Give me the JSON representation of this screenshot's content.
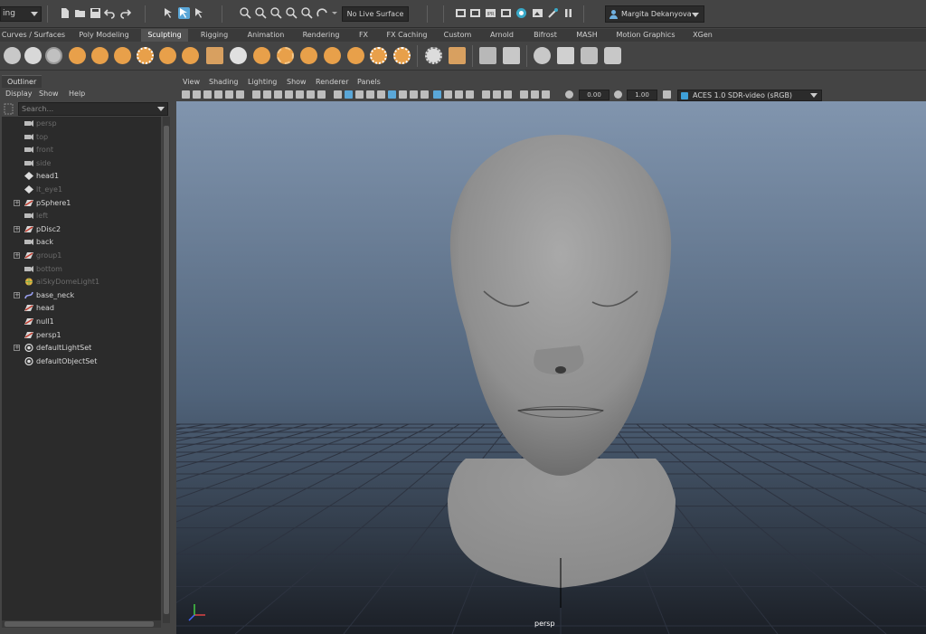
{
  "status_line": {
    "menu_set": "ing",
    "live_surface": "No Live Surface",
    "user_name": "Margita Dekanyova"
  },
  "shelf_tabs": [
    {
      "label": "Curves / Surfaces",
      "active": false
    },
    {
      "label": "Poly Modeling",
      "active": false
    },
    {
      "label": "Sculpting",
      "active": true
    },
    {
      "label": "Rigging",
      "active": false
    },
    {
      "label": "Animation",
      "active": false
    },
    {
      "label": "Rendering",
      "active": false
    },
    {
      "label": "FX",
      "active": false
    },
    {
      "label": "FX Caching",
      "active": false
    },
    {
      "label": "Custom",
      "active": false
    },
    {
      "label": "Arnold",
      "active": false
    },
    {
      "label": "Bifrost",
      "active": false
    },
    {
      "label": "MASH",
      "active": false
    },
    {
      "label": "Motion Graphics",
      "active": false
    },
    {
      "label": "XGen",
      "active": false
    }
  ],
  "outliner": {
    "title": "Outliner",
    "menus": [
      "Display",
      "Show",
      "Help"
    ],
    "search_placeholder": "Search...",
    "items": [
      {
        "label": "persp",
        "icon": "camera-icon",
        "dim": true,
        "expandable": false
      },
      {
        "label": "top",
        "icon": "camera-icon",
        "dim": true,
        "expandable": false
      },
      {
        "label": "front",
        "icon": "camera-icon",
        "dim": true,
        "expandable": false
      },
      {
        "label": "side",
        "icon": "camera-icon",
        "dim": true,
        "expandable": false
      },
      {
        "label": "head1",
        "icon": "locator-icon",
        "dim": false,
        "expandable": false
      },
      {
        "label": "lt_eye1",
        "icon": "locator-icon",
        "dim": true,
        "expandable": false
      },
      {
        "label": "pSphere1",
        "icon": "mesh-icon",
        "dim": false,
        "expandable": true
      },
      {
        "label": "left",
        "icon": "camera-icon",
        "dim": true,
        "expandable": false
      },
      {
        "label": "pDisc2",
        "icon": "mesh-icon",
        "dim": false,
        "expandable": true
      },
      {
        "label": "back",
        "icon": "camera-icon",
        "dim": false,
        "expandable": false
      },
      {
        "label": "group1",
        "icon": "mesh-icon",
        "dim": true,
        "expandable": true
      },
      {
        "label": "bottom",
        "icon": "camera-icon",
        "dim": true,
        "expandable": false
      },
      {
        "label": "aiSkyDomeLight1",
        "icon": "light-icon",
        "dim": true,
        "expandable": false
      },
      {
        "label": "base_neck",
        "icon": "curve-icon",
        "dim": false,
        "expandable": true
      },
      {
        "label": "head",
        "icon": "mesh-icon",
        "dim": false,
        "expandable": false
      },
      {
        "label": "null1",
        "icon": "mesh-icon",
        "dim": false,
        "expandable": false
      },
      {
        "label": "persp1",
        "icon": "mesh-icon",
        "dim": false,
        "expandable": false
      },
      {
        "label": "defaultLightSet",
        "icon": "set-icon",
        "dim": false,
        "expandable": true
      },
      {
        "label": "defaultObjectSet",
        "icon": "set-icon",
        "dim": false,
        "expandable": false
      }
    ]
  },
  "viewport": {
    "menus": [
      "View",
      "Shading",
      "Lighting",
      "Show",
      "Renderer",
      "Panels"
    ],
    "exposure": "0.00",
    "gamma": "1.00",
    "color_space": "ACES 1.0 SDR-video (sRGB)",
    "camera": "persp"
  },
  "colors": {
    "background": "#444444",
    "field": "#2b2b2b",
    "accent": "#5aa7d8",
    "shelf_orange": "#e8a04a",
    "viewport_top": "#7f93ad",
    "viewport_bottom": "#1a1d23"
  }
}
